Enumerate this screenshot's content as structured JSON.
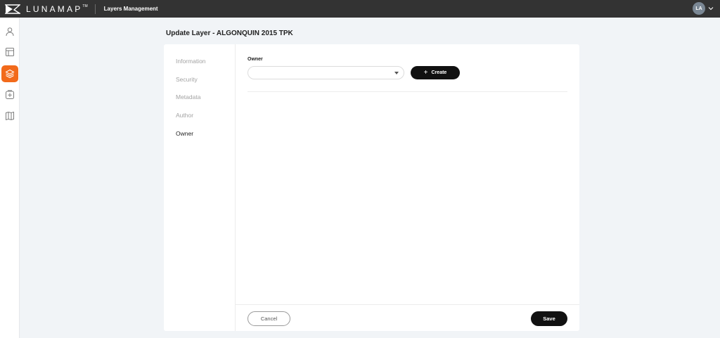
{
  "topbar": {
    "brand": "LUNAMAP",
    "trademark": "TM",
    "app_title": "Layers Management",
    "user_initials": "LA"
  },
  "sidebar": {
    "items": [
      {
        "icon": "user-icon",
        "active": false
      },
      {
        "icon": "layout-icon",
        "active": false
      },
      {
        "icon": "layers-icon",
        "active": true
      },
      {
        "icon": "add-tile-icon",
        "active": false
      },
      {
        "icon": "map-icon",
        "active": false
      }
    ],
    "accent_color": "#f26a1b"
  },
  "page": {
    "title": "Update Layer - ALGONQUIN 2015 TPK"
  },
  "tabs": [
    "Information",
    "Security",
    "Metadata",
    "Author",
    "Owner"
  ],
  "active_tab": "Owner",
  "owner_form": {
    "label": "Owner",
    "selected_value": "",
    "create_label": "Create"
  },
  "footer": {
    "cancel_label": "Cancel",
    "save_label": "Save"
  }
}
